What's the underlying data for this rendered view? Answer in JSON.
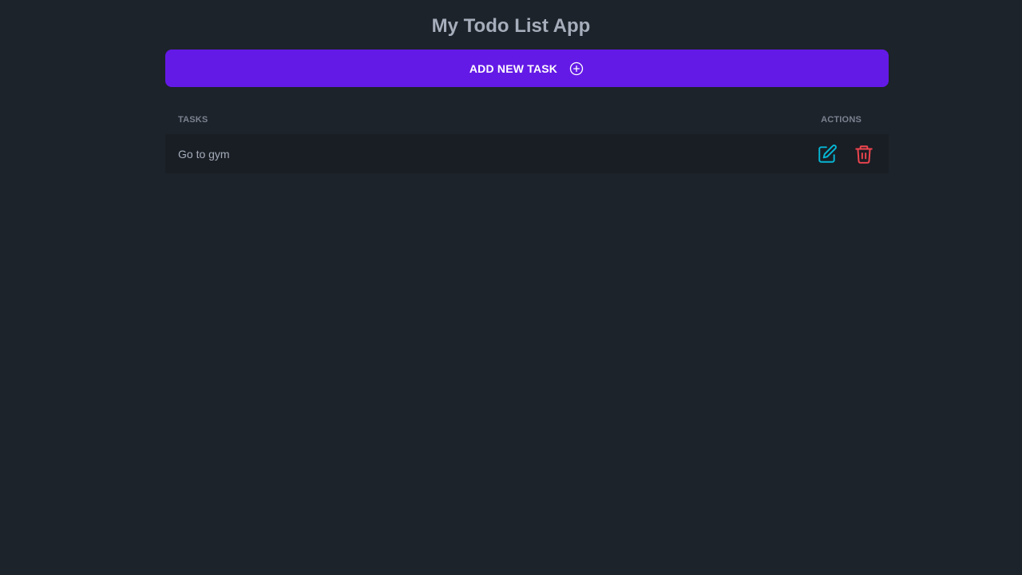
{
  "app": {
    "title": "My Todo List App"
  },
  "toolbar": {
    "add_label": "ADD NEW TASK",
    "add_icon": "plus-circle-icon"
  },
  "table": {
    "columns": [
      "TASKS",
      "ACTIONS"
    ],
    "rows": [
      {
        "task": "Go to gym",
        "edit_icon": "edit-icon",
        "delete_icon": "trash-icon"
      }
    ]
  },
  "colors": {
    "background": "#1d232a",
    "primary": "#641ae6",
    "edit": "#06b6d4",
    "delete": "#f0454f",
    "row_bg": "#191e24"
  }
}
